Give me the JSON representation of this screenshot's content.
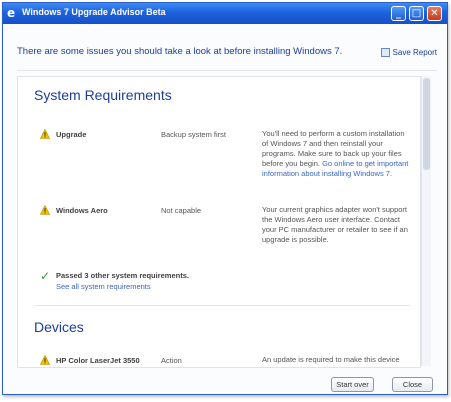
{
  "window": {
    "title": "Windows 7 Upgrade Advisor Beta",
    "controls": {
      "minimize": "_",
      "maximize": "□",
      "close": "✕"
    }
  },
  "header": {
    "intro": "There are some issues you should take a look at before installing Windows 7.",
    "save_report": "Save Report"
  },
  "system_requirements": {
    "title": "System Requirements",
    "items": [
      {
        "name": "Upgrade",
        "status": "Backup system first",
        "description": "You'll need to perform a custom installation of Windows 7 and then reinstall your programs. Make sure to back up your files before you begin.",
        "link": "Go online to get important information about installing Windows 7.",
        "icon": "warning-icon"
      },
      {
        "name": "Windows Aero",
        "status": "Not capable",
        "description": "Your current graphics adapter won't support the Windows Aero user interface. Contact your PC manufacturer or retailer to see if an upgrade is possible.",
        "icon": "warning-icon"
      }
    ],
    "passed": {
      "text": "Passed 3 other system requirements.",
      "link": "See all system requirements",
      "icon": "checkmark-icon"
    }
  },
  "devices": {
    "title": "Devices",
    "items": [
      {
        "name": "HP Color LaserJet 3550",
        "status": "Action",
        "description": "An update is required to make this device",
        "icon": "warning-icon"
      }
    ]
  },
  "footer": {
    "start_over": "Start over",
    "close": "Close"
  },
  "colors": {
    "title_bar": "#1f62dc",
    "heading": "#1d3e99",
    "link": "#3a66c4",
    "warning": "#f2c200",
    "ok": "#2f9a2f"
  }
}
